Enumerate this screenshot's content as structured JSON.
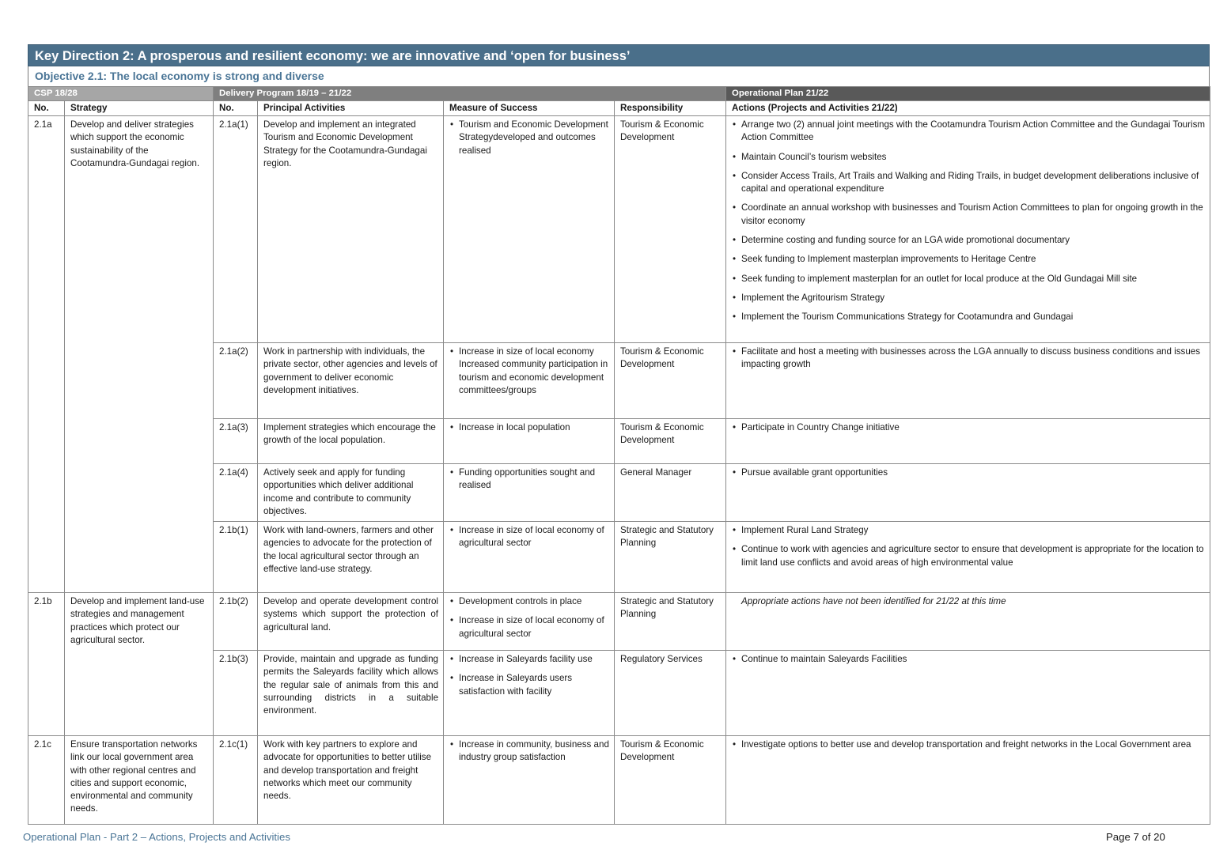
{
  "header": {
    "key_direction": "Key Direction 2: A prosperous and resilient economy: we are innovative and ‘open for business’",
    "objective": "Objective 2.1: The local economy is strong and diverse"
  },
  "sections": {
    "csp": "CSP 18/28",
    "delivery": "Delivery Program 18/19 – 21/22",
    "operational": "Operational Plan 21/22"
  },
  "columns": {
    "no": "No.",
    "strategy": "Strategy",
    "dp_no": "No.",
    "activities": "Principal Activities",
    "measure": "Measure of Success",
    "responsibility": "Responsibility",
    "actions": "Actions (Projects and Activities 21/22)"
  },
  "strategies": [
    {
      "no": "2.1a",
      "text": "Develop and deliver strategies which support the economic sustainability of the Cootamundra-Gundagai region."
    },
    {
      "no": "2.1b",
      "text": "Develop and implement land-use strategies and management practices which protect our agricultural sector."
    },
    {
      "no": "2.1c",
      "text": "Ensure transportation networks link our local government area with other regional centres and cities and support economic, environmental and community needs."
    }
  ],
  "rows": [
    {
      "no": "2.1a(1)",
      "activity": "Develop and implement an integrated Tourism and Economic Development Strategy for the Cootamundra-Gundagai region.",
      "measures": [
        "Tourism and Economic Development Strategydeveloped and outcomes realised"
      ],
      "responsibility": "Tourism & Economic Development",
      "actions": [
        "Arrange two (2) annual joint meetings with the Cootamundra Tourism Action Committee and the Gundagai Tourism Action Committee",
        "Maintain Council’s tourism websites",
        "Consider Access Trails, Art Trails and Walking and Riding Trails, in budget development deliberations inclusive of capital and operational expenditure",
        "Coordinate an annual workshop with businesses and Tourism Action Committees to plan for ongoing growth in the visitor economy",
        "Determine costing and funding source for an LGA wide promotional documentary",
        "Seek funding to Implement masterplan improvements to Heritage Centre",
        "Seek funding to implement masterplan for an outlet for local produce at the Old Gundagai Mill site",
        "Implement the Agritourism Strategy",
        "Implement the Tourism Communications Strategy for Cootamundra and Gundagai"
      ]
    },
    {
      "no": "2.1a(2)",
      "activity": "Work in partnership with individuals, the private sector, other agencies and levels of government to deliver economic development initiatives.",
      "measures": [
        "Increase in size of local economy Increased community participation in tourism and economic development committees/groups"
      ],
      "responsibility": "Tourism & Economic Development",
      "actions": [
        "Facilitate and host a meeting with businesses across the LGA annually to discuss business conditions and issues impacting growth"
      ]
    },
    {
      "no": "2.1a(3)",
      "activity": "Implement strategies which encourage the growth of the local population.",
      "measures": [
        "Increase in local population"
      ],
      "responsibility": "Tourism & Economic Development",
      "actions": [
        "Participate in Country Change initiative"
      ]
    },
    {
      "no": "2.1a(4)",
      "activity": "Actively seek and apply for funding opportunities which deliver additional income and contribute to community objectives.",
      "measures": [
        "Funding opportunities sought and realised"
      ],
      "responsibility": "General Manager",
      "actions": [
        "Pursue available grant opportunities"
      ]
    },
    {
      "no": "2.1b(1)",
      "activity": "Work with land-owners, farmers and other agencies to advocate for the protection of the local agricultural sector through an effective land-use strategy.",
      "measures": [
        "Increase in size of local economy of agricultural sector"
      ],
      "responsibility": "Strategic and Statutory Planning",
      "actions": [
        "Implement Rural Land Strategy",
        "Continue to work with agencies and agriculture sector to ensure that development is appropriate for the location to limit land use conflicts and avoid areas of high environmental value"
      ]
    },
    {
      "no": "2.1b(2)",
      "activity": "Develop and operate development control systems which support the protection of agricultural land.",
      "measures": [
        "Development controls in place",
        "Increase in size of local economy of agricultural sector"
      ],
      "responsibility": "Strategic and Statutory Planning",
      "note": "Appropriate actions have not been identified for 21/22 at this time"
    },
    {
      "no": "2.1b(3)",
      "activity": "Provide, maintain and upgrade as funding permits the Saleyards facility which allows the regular sale of animals from this and surrounding districts in a suitable environment.",
      "measures": [
        "Increase in Saleyards facility use",
        "Increase in Saleyards users satisfaction with facility"
      ],
      "responsibility": "Regulatory Services",
      "actions": [
        "Continue to maintain Saleyards Facilities"
      ]
    },
    {
      "no": "2.1c(1)",
      "activity": "Work with key partners to explore and advocate for opportunities to better utilise and develop transportation and freight networks which meet our community needs.",
      "measures": [
        "Increase in community, business and industry group satisfaction"
      ],
      "responsibility": "Tourism & Economic Development",
      "actions": [
        "Investigate options to better use and develop transportation and freight networks in the Local Government area"
      ]
    }
  ],
  "footer": {
    "left": "Operational Plan - Part 2 – Actions, Projects and Activities",
    "right": "Page 7 of 20"
  }
}
